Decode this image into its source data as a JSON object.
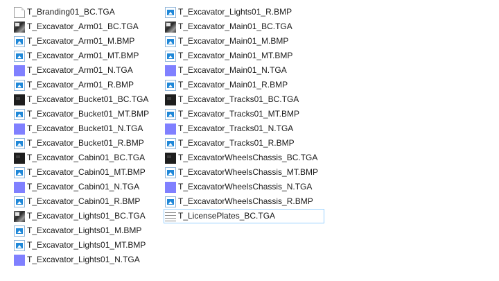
{
  "explorer": {
    "columns": [
      {
        "items": [
          {
            "name": "T_Branding01_BC.TGA",
            "icon": "document-icon"
          },
          {
            "name": "T_Excavator_Arm01_BC.TGA",
            "icon": "texture-thumbnail-icon"
          },
          {
            "name": "T_Excavator_Arm01_M.BMP",
            "icon": "bitmap-icon"
          },
          {
            "name": "T_Excavator_Arm01_MT.BMP",
            "icon": "bitmap-icon"
          },
          {
            "name": "T_Excavator_Arm01_N.TGA",
            "icon": "normal-map-thumbnail-icon"
          },
          {
            "name": "T_Excavator_Arm01_R.BMP",
            "icon": "bitmap-icon"
          },
          {
            "name": "T_Excavator_Bucket01_BC.TGA",
            "icon": "dark-texture-thumbnail-icon"
          },
          {
            "name": "T_Excavator_Bucket01_MT.BMP",
            "icon": "bitmap-icon"
          },
          {
            "name": "T_Excavator_Bucket01_N.TGA",
            "icon": "normal-map-thumbnail-icon"
          },
          {
            "name": "T_Excavator_Bucket01_R.BMP",
            "icon": "bitmap-icon"
          },
          {
            "name": "T_Excavator_Cabin01_BC.TGA",
            "icon": "dark-texture-thumbnail-icon"
          },
          {
            "name": "T_Excavator_Cabin01_MT.BMP",
            "icon": "bitmap-icon"
          },
          {
            "name": "T_Excavator_Cabin01_N.TGA",
            "icon": "normal-map-thumbnail-icon"
          },
          {
            "name": "T_Excavator_Cabin01_R.BMP",
            "icon": "bitmap-icon"
          },
          {
            "name": "T_Excavator_Lights01_BC.TGA",
            "icon": "texture-thumbnail-icon"
          },
          {
            "name": "T_Excavator_Lights01_M.BMP",
            "icon": "bitmap-icon"
          },
          {
            "name": "T_Excavator_Lights01_MT.BMP",
            "icon": "bitmap-icon"
          },
          {
            "name": "T_Excavator_Lights01_N.TGA",
            "icon": "normal-map-thumbnail-icon"
          }
        ]
      },
      {
        "items": [
          {
            "name": "T_Excavator_Lights01_R.BMP",
            "icon": "bitmap-icon"
          },
          {
            "name": "T_Excavator_Main01_BC.TGA",
            "icon": "texture-thumbnail-icon"
          },
          {
            "name": "T_Excavator_Main01_M.BMP",
            "icon": "bitmap-icon"
          },
          {
            "name": "T_Excavator_Main01_MT.BMP",
            "icon": "bitmap-icon"
          },
          {
            "name": "T_Excavator_Main01_N.TGA",
            "icon": "normal-map-thumbnail-icon"
          },
          {
            "name": "T_Excavator_Main01_R.BMP",
            "icon": "bitmap-icon"
          },
          {
            "name": "T_Excavator_Tracks01_BC.TGA",
            "icon": "dark-texture-thumbnail-icon"
          },
          {
            "name": "T_Excavator_Tracks01_MT.BMP",
            "icon": "bitmap-icon"
          },
          {
            "name": "T_Excavator_Tracks01_N.TGA",
            "icon": "normal-map-thumbnail-icon"
          },
          {
            "name": "T_Excavator_Tracks01_R.BMP",
            "icon": "bitmap-icon"
          },
          {
            "name": "T_ExcavatorWheelsChassis_BC.TGA",
            "icon": "dark-texture-thumbnail-icon"
          },
          {
            "name": "T_ExcavatorWheelsChassis_MT.BMP",
            "icon": "bitmap-icon"
          },
          {
            "name": "T_ExcavatorWheelsChassis_N.TGA",
            "icon": "normal-map-thumbnail-icon"
          },
          {
            "name": "T_ExcavatorWheelsChassis_R.BMP",
            "icon": "bitmap-icon"
          },
          {
            "name": "T_LicensePlates_BC.TGA",
            "icon": "text-lines-thumbnail-icon",
            "focused": true
          }
        ]
      }
    ],
    "colors": {
      "focus_border": "#99d1ff",
      "normal_map_purple": "#8080ff",
      "bitmap_blue": "#1f88d9"
    }
  }
}
